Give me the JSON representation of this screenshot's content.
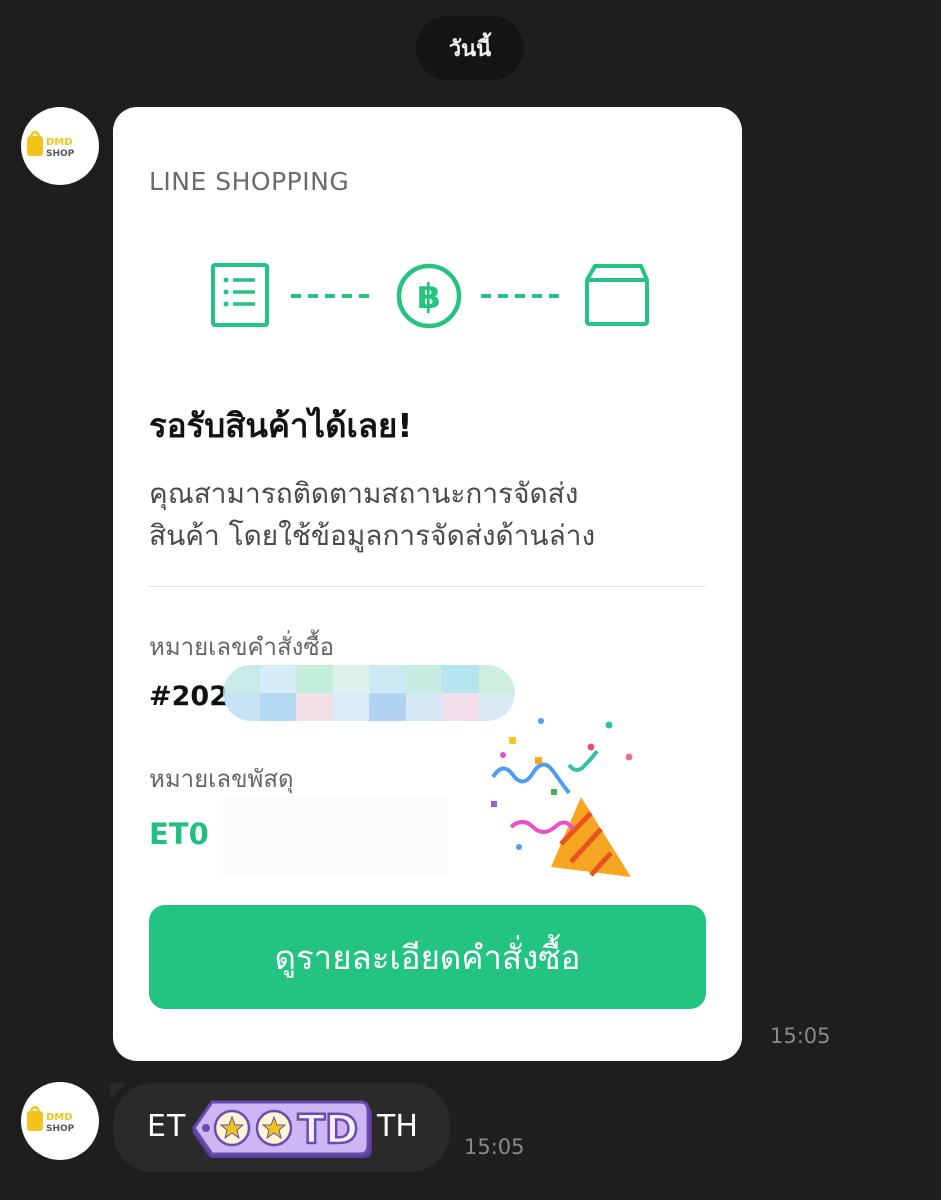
{
  "chat": {
    "date_label": "วันนี้"
  },
  "sender": {
    "avatar_brand_top": "DMD",
    "avatar_brand_bottom": "SHOP",
    "accent_color": "#f4c21b"
  },
  "order_card": {
    "brand": "LINE SHOPPING",
    "steps": [
      {
        "icon": "order-list-icon"
      },
      {
        "icon": "baht-coin-icon"
      },
      {
        "icon": "package-box-icon"
      }
    ],
    "title": "รอรับสินค้าได้เลย!",
    "description_line1": "คุณสามารถติดตามสถานะการจัดส่ง",
    "description_line2": "สินค้า โดยใช้ข้อมูลการจัดส่งด้านล่าง",
    "order_number_label": "หมายเลขคำสั่งซื้อ",
    "order_number_value": "#202",
    "tracking_label": "หมายเลขพัสดุ",
    "tracking_value": "ET0",
    "button_label": "ดูรายละเอียดคำสั่งซื้อ",
    "accent_color": "#23c381",
    "timestamp": "15:05"
  },
  "text_message": {
    "prefix": "ET",
    "suffix": "TH",
    "sticker_text": "TD",
    "timestamp": "15:05"
  }
}
